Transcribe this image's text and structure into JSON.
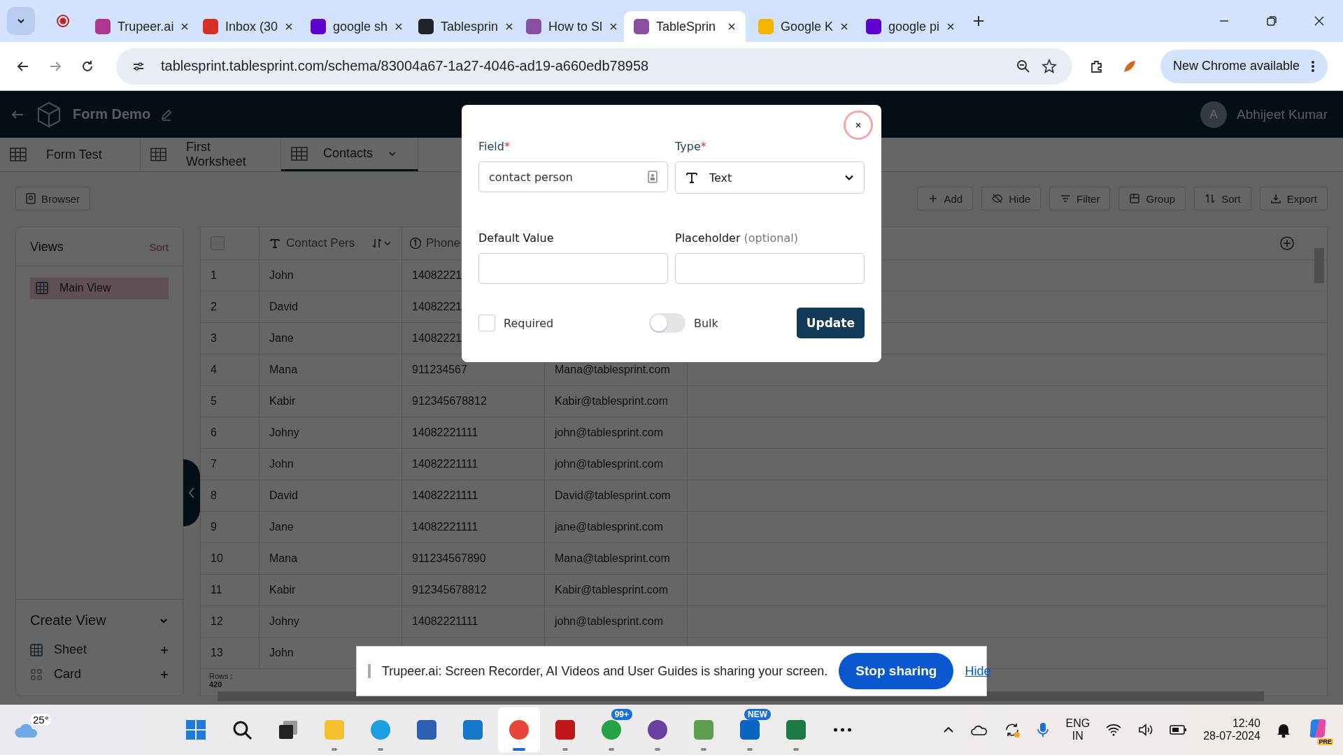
{
  "browser": {
    "tabs": [
      {
        "title": "Trupeer.ai",
        "color": "#b0358f",
        "selected": false
      },
      {
        "title": "Inbox (30",
        "color": "#d93025",
        "selected": false
      },
      {
        "title": "google sh",
        "color": "#5f01d1",
        "selected": false
      },
      {
        "title": "Tablesprin",
        "color": "#1f2328",
        "selected": false
      },
      {
        "title": "How to Sl",
        "color": "#8a4fa0",
        "selected": false
      },
      {
        "title": "TableSprin",
        "color": "#8a4fa0",
        "selected": true
      },
      {
        "title": "Google K",
        "color": "#f4b400",
        "selected": false
      },
      {
        "title": "google pi",
        "color": "#5f01d1",
        "selected": false
      }
    ],
    "url": "tablesprint.tablesprint.com/schema/83004a67-1a27-4046-ad19-a660edb78958",
    "update_button": "New Chrome available"
  },
  "app": {
    "title": "Form Demo",
    "user": {
      "initial": "A",
      "name": "Abhijeet Kumar"
    }
  },
  "sheet_tabs": [
    {
      "label": "Form Test",
      "selected": false
    },
    {
      "label": "First Worksheet",
      "selected": false
    },
    {
      "label": "Contacts",
      "selected": true
    }
  ],
  "toolbar": {
    "browser_button": "Browser",
    "actions": [
      {
        "label": "Add",
        "kind": "add"
      },
      {
        "label": "Hide",
        "kind": "hide"
      },
      {
        "label": "Filter",
        "kind": "filter"
      },
      {
        "label": "Group",
        "kind": "group"
      },
      {
        "label": "Sort",
        "kind": "sort"
      },
      {
        "label": "Export",
        "kind": "export"
      }
    ]
  },
  "sidebar": {
    "title": "Views",
    "sort": "Sort",
    "views": [
      {
        "label": "Main View",
        "selected": true
      }
    ],
    "create_title": "Create View",
    "create_items": [
      {
        "label": "Sheet",
        "kind": "sheet"
      },
      {
        "label": "Card",
        "kind": "card"
      }
    ]
  },
  "table": {
    "select_all_checked": false,
    "columns": [
      "Contact Pers",
      "Phone"
    ],
    "rows": [
      {
        "index": "1",
        "name": "John",
        "phone": "14082221"
      },
      {
        "index": "2",
        "name": "David",
        "phone": "14082221"
      },
      {
        "index": "3",
        "name": "Jane",
        "phone": "14082221"
      },
      {
        "index": "4",
        "name": "Mana",
        "phone": "911234567",
        "email": "Mana@tablesprint.com"
      },
      {
        "index": "5",
        "name": "Kabir",
        "phone": "912345678812",
        "email": "Kabir@tablesprint.com"
      },
      {
        "index": "6",
        "name": "Johny",
        "phone": "14082221111",
        "email": "john@tablesprint.com"
      },
      {
        "index": "7",
        "name": "John",
        "phone": "14082221111",
        "email": "john@tablesprint.com"
      },
      {
        "index": "8",
        "name": "David",
        "phone": "14082221111",
        "email": "David@tablesprint.com"
      },
      {
        "index": "9",
        "name": "Jane",
        "phone": "14082221111",
        "email": "jane@tablesprint.com"
      },
      {
        "index": "10",
        "name": "Mana",
        "phone": "911234567890",
        "email": "Mana@tablesprint.com"
      },
      {
        "index": "11",
        "name": "Kabir",
        "phone": "912345678812",
        "email": "Kabir@tablesprint.com"
      },
      {
        "index": "12",
        "name": "Johny",
        "phone": "14082221111",
        "email": "john@tablesprint.com"
      },
      {
        "index": "13",
        "name": "John"
      }
    ],
    "footer_label": "Rows :",
    "footer_count": "420"
  },
  "modal": {
    "field": {
      "label": "Field",
      "mark": "*",
      "value": "contact person"
    },
    "type": {
      "label": "Type",
      "mark": "*",
      "value": "Text"
    },
    "default_value": {
      "label": "Default Value"
    },
    "placeholder": {
      "label": "Placeholder",
      "hint": "(optional)"
    },
    "required": {
      "label": "Required",
      "checked": false
    },
    "bulk": {
      "label": "Bulk",
      "on": false
    },
    "submit": "Update"
  },
  "share_banner": {
    "message": "Trupeer.ai: Screen Recorder, AI Videos and User Guides is sharing your screen.",
    "stop": "Stop sharing",
    "hide": "Hide"
  },
  "taskbar": {
    "weather": "25°",
    "apps": [
      {
        "kind": "start",
        "running": false,
        "selected": false
      },
      {
        "kind": "search",
        "running": false,
        "selected": false
      },
      {
        "kind": "taskview",
        "running": false,
        "selected": false
      },
      {
        "kind": "explorer",
        "running": true,
        "selected": false
      },
      {
        "kind": "edge",
        "running": true,
        "selected": false
      },
      {
        "kind": "store",
        "running": false,
        "selected": false
      },
      {
        "kind": "dell",
        "running": false,
        "selected": false
      },
      {
        "kind": "chrome",
        "running": true,
        "selected": true
      },
      {
        "kind": "mcafee",
        "running": true,
        "selected": false
      },
      {
        "kind": "whatsapp",
        "running": true,
        "selected": false,
        "badge": "99+"
      },
      {
        "kind": "github",
        "running": true,
        "selected": false
      },
      {
        "kind": "paint",
        "running": true,
        "selected": false
      },
      {
        "kind": "outlook",
        "running": true,
        "selected": false,
        "badge": "NEW"
      },
      {
        "kind": "excel",
        "running": true,
        "selected": false
      },
      {
        "kind": "more",
        "running": false,
        "selected": false
      }
    ],
    "lang": "ENG",
    "region": "IN",
    "time": "12:40",
    "date": "28-07-2024",
    "copilot_badge": "PRE"
  }
}
